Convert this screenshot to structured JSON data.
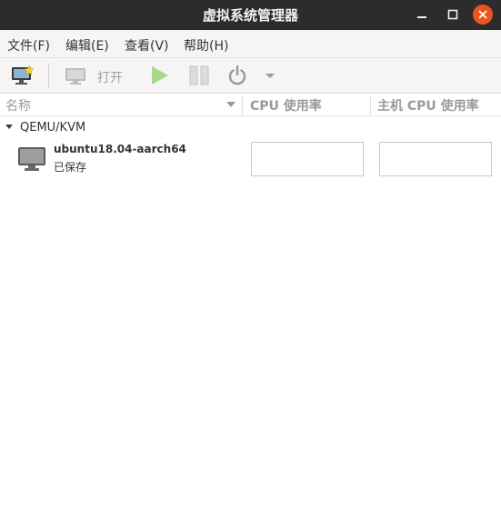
{
  "window": {
    "title": "虚拟系统管理器"
  },
  "menu": [
    "文件(F)",
    "编辑(E)",
    "查看(V)",
    "帮助(H)"
  ],
  "toolbar": {
    "open_label": "打开"
  },
  "columns": {
    "name": "名称",
    "cpu": "CPU 使用率",
    "host_cpu": "主机 CPU 使用率"
  },
  "connection": {
    "label": "QEMU/KVM",
    "expanded": true
  },
  "vm": {
    "name": "ubuntu18.04-aarch64",
    "status": "已保存"
  },
  "colors": {
    "titlebar": "#2c2c2c",
    "close": "#e95420",
    "run_disabled": "#a6d98a"
  }
}
